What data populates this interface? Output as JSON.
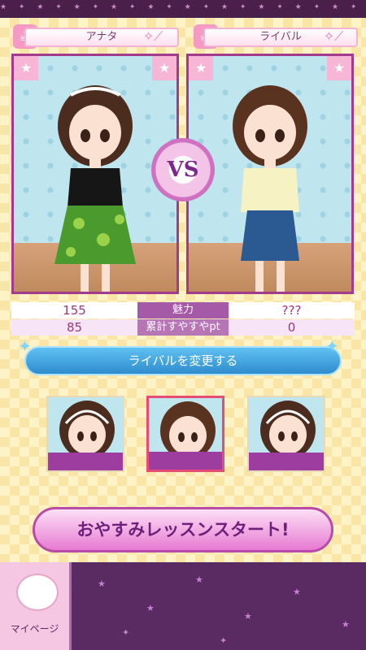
{
  "header": {
    "player_tab": "アナタ",
    "rival_tab": "ライバル"
  },
  "battle": {
    "vs_label": "VS"
  },
  "stats": {
    "rows": [
      {
        "label": "魅力",
        "player": "155",
        "rival": "???"
      },
      {
        "label": "累計すやすやpt",
        "player": "85",
        "rival": "0"
      }
    ]
  },
  "buttons": {
    "change_rival": "ライバルを変更する",
    "start_lesson": "おやすみレッスンスタート!",
    "my_page": "マイページ"
  },
  "rival_choices": [
    {
      "selected": false
    },
    {
      "selected": true
    },
    {
      "selected": false
    }
  ],
  "colors": {
    "frame": "#a23b8e",
    "stat_label_bg": "#a45aa6",
    "change_button": "#2f8ccd",
    "start_button": "#e77ad1",
    "bottom_bar": "#5a2a63"
  },
  "icons": [
    "cup-icon",
    "wand-icon",
    "star-icon",
    "sheep-icon",
    "sparkle-icon"
  ]
}
